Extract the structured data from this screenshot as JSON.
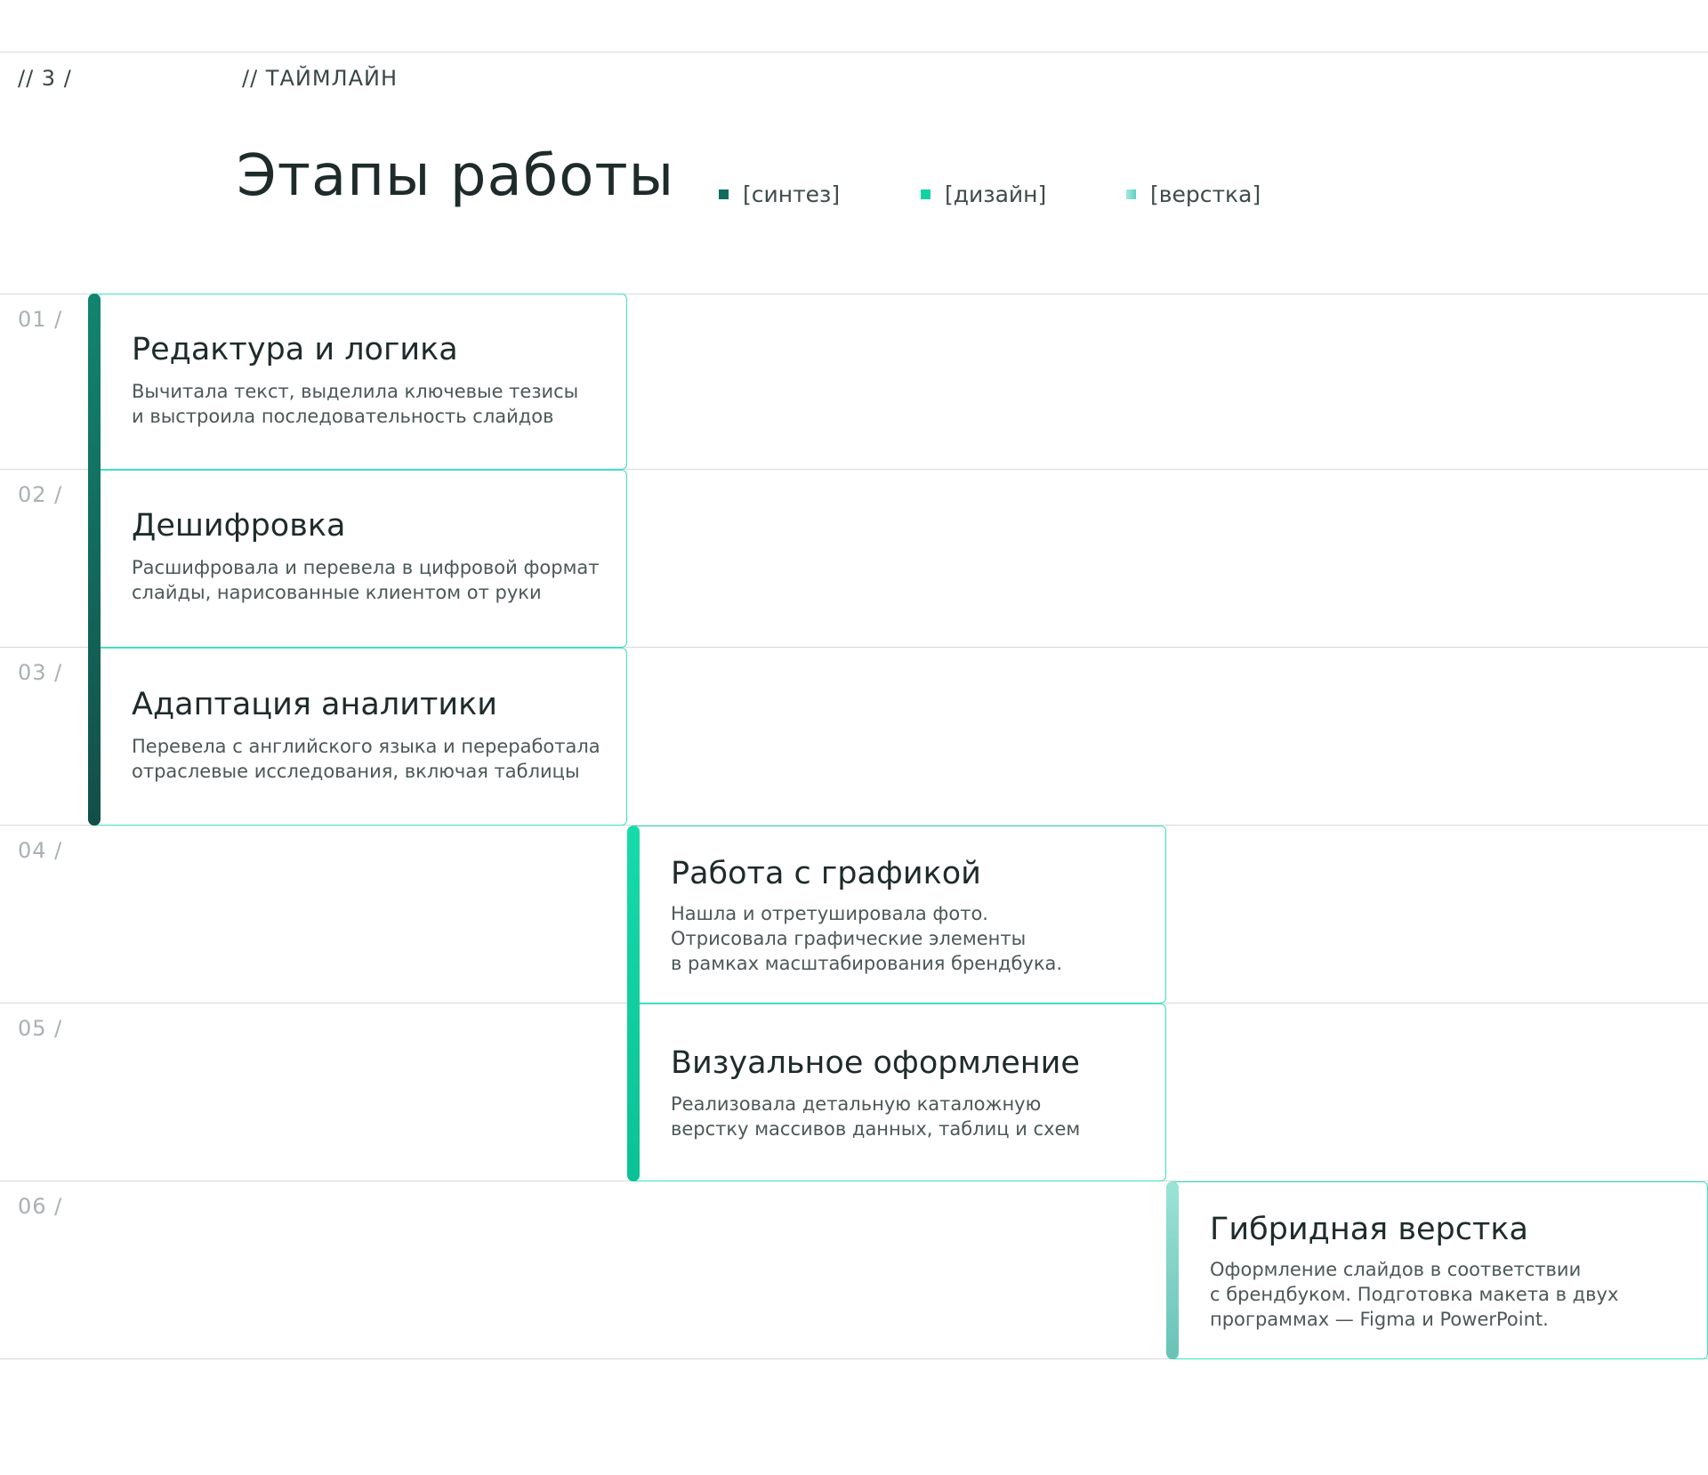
{
  "header": {
    "section_number": "// 3 /",
    "section_label": "// ТАЙМЛАЙН",
    "title": "Этапы работы"
  },
  "legend": [
    {
      "label": "[синтез]",
      "color": "#0f6b5f"
    },
    {
      "label": "[дизайн]",
      "color": "#12d3a6"
    },
    {
      "label": "[верстка]",
      "color": "#7fd9cb"
    }
  ],
  "rows": [
    {
      "number": "01 /",
      "title": "Редактура и логика",
      "description": "Вычитала текст, выделила ключевые тезисы\nи выстроила последовательность слайдов",
      "phase": "[синтез]"
    },
    {
      "number": "02 /",
      "title": "Дешифровка",
      "description": "Расшифровала и перевела в цифровой формат\nслайды, нарисованные клиентом от руки",
      "phase": "[синтез]"
    },
    {
      "number": "03 /",
      "title": "Адаптация аналитики",
      "description": "Перевела с английского языка и переработала\nотраслевые исследования, включая таблицы",
      "phase": "[синтез]"
    },
    {
      "number": "04 /",
      "title": "Работа с графикой",
      "description": "Нашла и отретушировала фото.\nОтрисовала графические элементы\nв рамках масштабирования брендбука.",
      "phase": "[дизайн]"
    },
    {
      "number": "05 /",
      "title": "Визуальное оформление",
      "description": "Реализовала детальную каталожную\nверстку массивов данных, таблиц и схем",
      "phase": "[дизайн]"
    },
    {
      "number": "06 /",
      "title": "Гибридная верстка",
      "description": "Оформление слайдов в соответствии\nс брендбуком. Подготовка макета в двух\nпрограммах — Figma и PowerPoint.",
      "phase": "[верстка]"
    }
  ]
}
